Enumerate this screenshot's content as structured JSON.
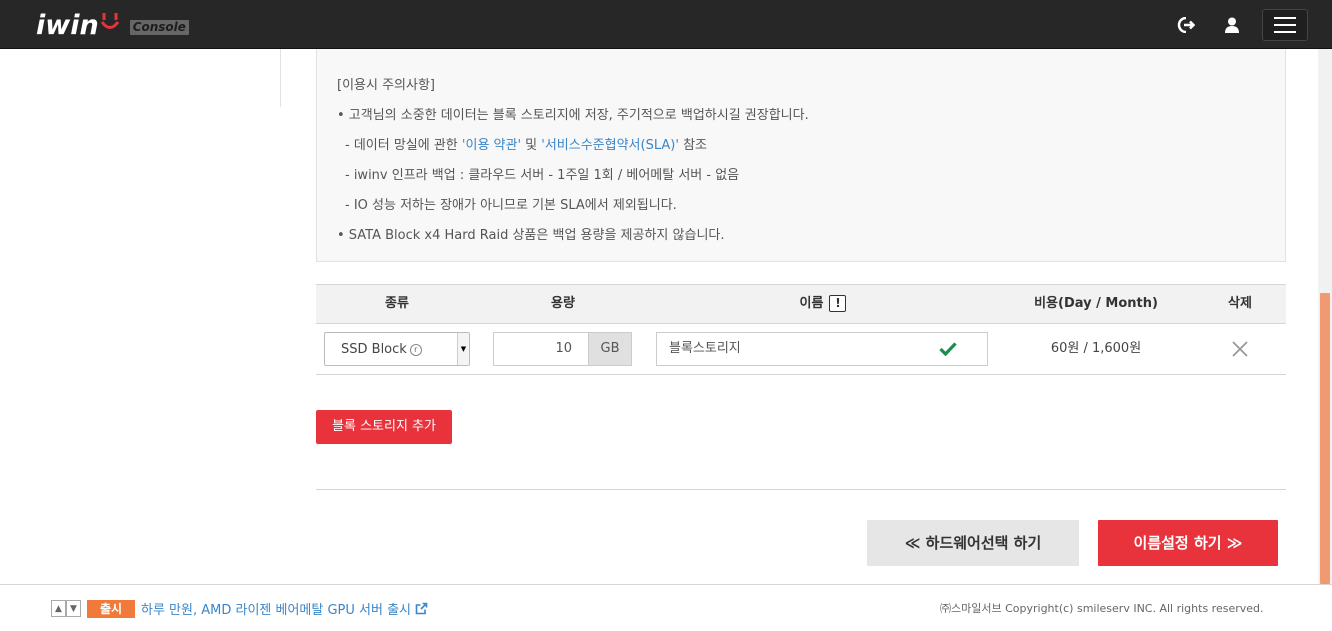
{
  "header": {
    "logo_text": "iwin",
    "console_label": "Console",
    "icons": {
      "logout": "logout-icon",
      "user": "user-icon",
      "menu": "hamburger-icon"
    }
  },
  "notice": {
    "title": "[이용시 주의사항]",
    "line1": "• 고객님의 소중한 데이터는 블록 스토리지에 저장, 주기적으로 백업하시길 권장합니다.",
    "line2_prefix": "- 데이터 망실에 관한 ",
    "line2_link1": "'이용 약관'",
    "line2_mid": " 및 ",
    "line2_link2": "'서비스수준협약서(SLA)'",
    "line2_suffix": " 참조",
    "line3": "- iwinv 인프라 백업 : 클라우드 서버 - 1주일 1회 / 베어메탈 서버 - 없음",
    "line4": "- IO 성능 저하는 장애가 아니므로 기본 SLA에서 제외됩니다.",
    "line5": "• SATA Block x4 Hard Raid 상품은 백업 용량을 제공하지 않습니다."
  },
  "table": {
    "headers": {
      "type": "종류",
      "capacity": "용량",
      "name": "이름",
      "name_hint": "!",
      "cost": "비용(Day / Month)",
      "delete": "삭제"
    },
    "rows": [
      {
        "type": "SSD Block",
        "type_mark": "r",
        "capacity": "10",
        "unit": "GB",
        "name": "블록스토리지",
        "cost": "60원 / 1,600원"
      }
    ]
  },
  "buttons": {
    "add": "블록 스토리지 추가",
    "prev": "≪ 하드웨어선택 하기",
    "next": "이름설정 하기 ≫"
  },
  "footer": {
    "badge": "출시",
    "news": "하루 만원, AMD 라이젠 베어메탈 GPU 서버 출시",
    "copyright": "㈜스마일서브 Copyright(c) smileserv INC. All rights reserved."
  },
  "colors": {
    "accent": "#e8323c",
    "link": "#3a86c8",
    "badge": "#f17a3a",
    "topbar": "#272727"
  }
}
